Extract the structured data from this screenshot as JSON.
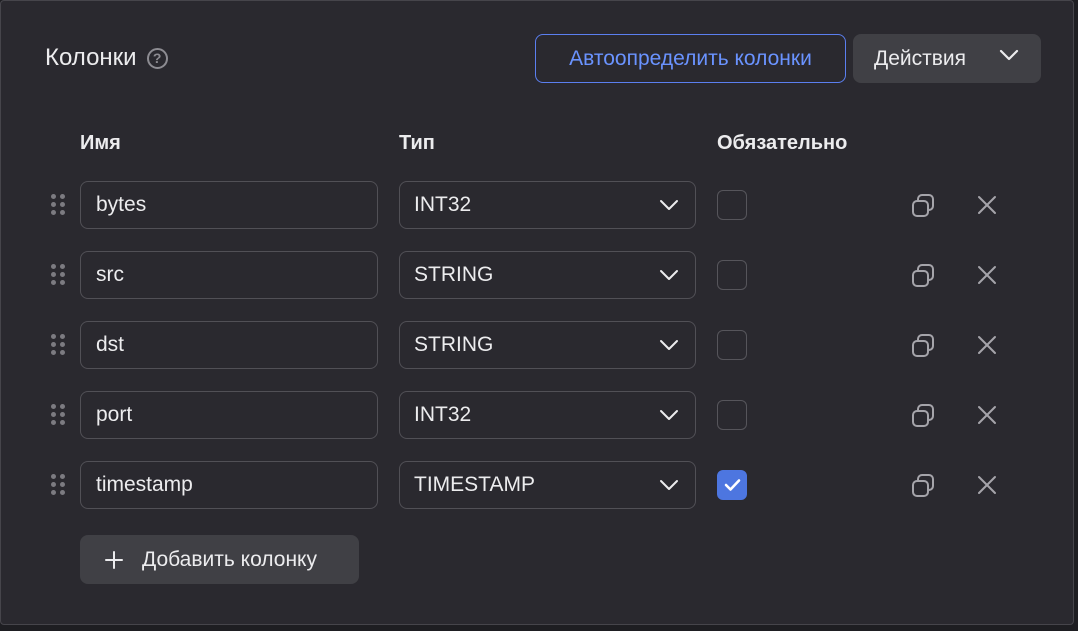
{
  "header": {
    "title": "Колонки",
    "help_symbol": "?",
    "autodetect_label": "Автоопределить колонки",
    "actions_label": "Действия"
  },
  "columns_header": {
    "name": "Имя",
    "type": "Тип",
    "required": "Обязательно"
  },
  "rows": [
    {
      "name": "bytes",
      "type": "INT32",
      "required": false
    },
    {
      "name": "src",
      "type": "STRING",
      "required": false
    },
    {
      "name": "dst",
      "type": "STRING",
      "required": false
    },
    {
      "name": "port",
      "type": "INT32",
      "required": false
    },
    {
      "name": "timestamp",
      "type": "TIMESTAMP",
      "required": true
    }
  ],
  "footer": {
    "add_label": "Добавить колонку"
  },
  "colors": {
    "accent": "#4d76e0",
    "accent_text": "#6a93ff",
    "panel_bg": "#2a292f"
  }
}
